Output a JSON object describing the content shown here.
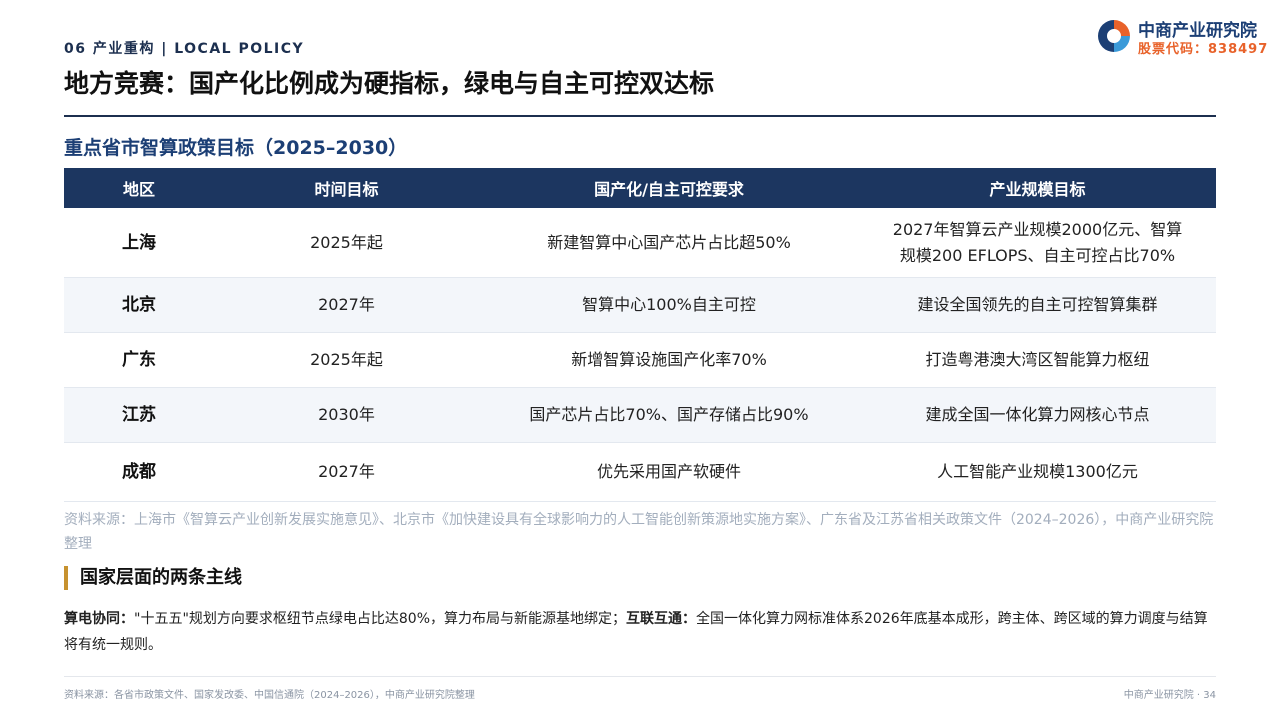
{
  "header": {
    "section_tag": "06 产业重构 | LOCAL POLICY",
    "title": "地方竞赛：国产化比例成为硬指标，绿电与自主可控双达标"
  },
  "logo": {
    "name": "中商产业研究院",
    "code": "股票代码：838497",
    "colors": {
      "primary": "#1c3f75",
      "accent": "#e8622a"
    }
  },
  "subtitle": "重点省市智算政策目标（2025–2030）",
  "table": {
    "headers": [
      "地区",
      "时间目标",
      "国产化/自主可控要求",
      "产业规模目标"
    ],
    "rows": [
      {
        "region": "上海",
        "time": "2025年起",
        "requirement": "新建智算中心国产芯片占比超50%",
        "scale_1": "2027年智算云产业规模2000亿元、智算",
        "scale_2": "规模200 EFLOPS、自主可控占比70%"
      },
      {
        "region": "北京",
        "time": "2027年",
        "requirement": "智算中心100%自主可控",
        "scale": "建设全国领先的自主可控智算集群"
      },
      {
        "region": "广东",
        "time": "2025年起",
        "requirement": "新增智算设施国产化率70%",
        "scale": "打造粤港澳大湾区智能算力枢纽"
      },
      {
        "region": "江苏",
        "time": "2030年",
        "requirement": "国产芯片占比70%、国产存储占比90%",
        "scale": "建成全国一体化算力网核心节点"
      },
      {
        "region": "成都",
        "time": "2027年",
        "requirement": "优先采用国产软硬件",
        "scale": "人工智能产业规模1300亿元"
      }
    ]
  },
  "source": "资料来源：上海市《智算云产业创新发展实施意见》、北京市《加快建设具有全球影响力的人工智能创新策源地实施方案》、广东省及江苏省相关政策文件（2024–2026），中商产业研究院整理",
  "national": {
    "heading": "国家层面的两条主线",
    "point1_label": "算电协同：",
    "point1_text": "\"十五五\"规划方向要求枢纽节点绿电占比达80%，算力布局与新能源基地绑定；",
    "point2_label": "互联互通：",
    "point2_text": "全国一体化算力网标准体系2026年底基本成形，跨主体、跨区域的算力调度与结算将有统一规则。"
  },
  "footer": {
    "source": "资料来源：各省市政策文件、国家发改委、中国信通院（2024–2026），中商产业研究院整理",
    "page": "中商产业研究院 · 34"
  },
  "colors": {
    "table_header_bg": "#1c3660",
    "accent_bar": "#c7922f",
    "row_alt_bg": "#f3f6fa"
  }
}
